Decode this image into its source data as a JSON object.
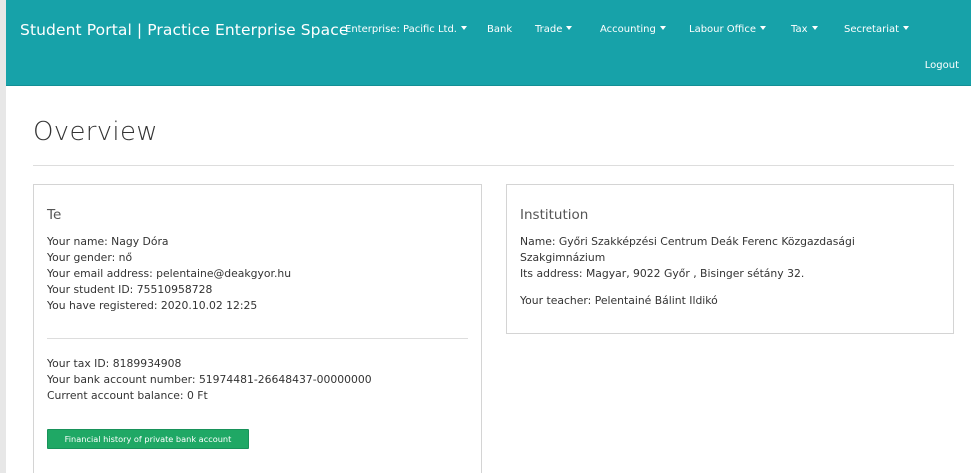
{
  "navbar": {
    "brand": "Student Portal | Practice Enterprise Space",
    "items": [
      {
        "label": "Enterprise: Pacific Ltd.",
        "dropdown": true
      },
      {
        "label": "Bank",
        "dropdown": false
      },
      {
        "label": "Trade",
        "dropdown": true
      },
      {
        "label": "Accounting",
        "dropdown": true
      },
      {
        "label": "Labour Office",
        "dropdown": true
      },
      {
        "label": "Tax",
        "dropdown": true
      },
      {
        "label": "Secretariat",
        "dropdown": true
      }
    ],
    "logout": "Logout",
    "background_color": "#17a2a9"
  },
  "page": {
    "title": "Overview"
  },
  "you_panel": {
    "heading": "Te",
    "personal": [
      "Your name: Nagy Dóra",
      "Your gender: nő",
      "Your email address: pelentaine@deakgyor.hu",
      "Your student ID: 75510958728",
      "You have registered: 2020.10.02 12:25"
    ],
    "financial": [
      "Your tax ID: 8189934908",
      "Your bank account number: 51974481-26648437-00000000",
      "Current account balance: 0 Ft"
    ],
    "history_button": "Financial history of private bank account",
    "button_color": "#1fa865"
  },
  "institution_panel": {
    "heading": "Institution",
    "name_line1": "Name: Győri Szakképzési Centrum Deák Ferenc Közgazdasági",
    "name_line2": "Szakgimnázium",
    "address": "Its address: Magyar, 9022 Győr , Bisinger sétány 32.",
    "teacher": "Your teacher: Pelentainé Bálint Ildikó"
  }
}
